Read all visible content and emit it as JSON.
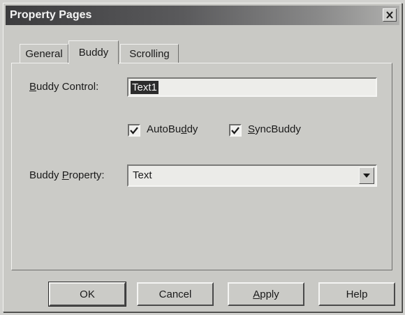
{
  "window": {
    "title": "Property Pages"
  },
  "tabs": [
    {
      "label": "General"
    },
    {
      "label": "Buddy"
    },
    {
      "label": "Scrolling"
    }
  ],
  "active_tab": "Buddy",
  "buddy_control": {
    "label_u": "B",
    "label_rest": "uddy Control:",
    "value": "Text1"
  },
  "checkboxes": {
    "autobuddy": {
      "checked": true,
      "label_pre": "AutoBu",
      "label_u": "d",
      "label_post": "dy"
    },
    "syncbuddy": {
      "checked": true,
      "label_u": "S",
      "label_post": "yncBuddy"
    }
  },
  "buddy_property": {
    "label_pre": "Buddy ",
    "label_u": "P",
    "label_post": "roperty:",
    "value": "Text"
  },
  "buttons": {
    "ok": "OK",
    "cancel": "Cancel",
    "apply_u": "A",
    "apply_rest": "pply",
    "help": "Help"
  },
  "icons": {
    "close": "close-icon",
    "check": "checkmark-icon",
    "dropdown": "dropdown-arrow-icon"
  }
}
